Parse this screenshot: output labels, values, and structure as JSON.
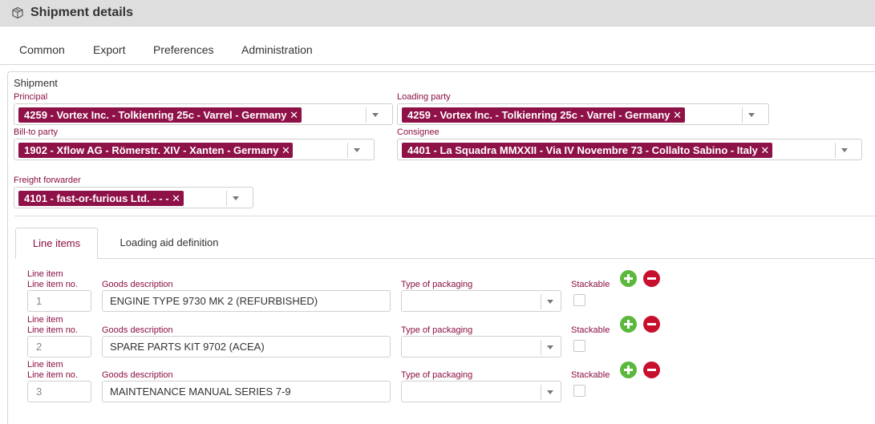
{
  "window": {
    "title": "Shipment details",
    "icon": "package-icon"
  },
  "menu": {
    "items": [
      {
        "label": "Common"
      },
      {
        "label": "Export"
      },
      {
        "label": "Preferences"
      },
      {
        "label": "Administration"
      }
    ]
  },
  "shipment": {
    "section_title": "Shipment",
    "principal": {
      "label": "Principal",
      "value": "4259 - Vortex Inc. - Tolkienring 25c - Varrel - Germany"
    },
    "loading_party": {
      "label": "Loading party",
      "value": "4259 - Vortex Inc. - Tolkienring 25c - Varrel - Germany"
    },
    "bill_to_party": {
      "label": "Bill-to party",
      "value": "1902 - Xflow AG - Römerstr. XIV - Xanten - Germany"
    },
    "consignee": {
      "label": "Consignee",
      "value": "4401 - La Squadra MMXXII - Via IV Novembre 73 - Collalto Sabino - Italy"
    },
    "freight_forwarder": {
      "label": "Freight forwarder",
      "value": "4101 - fast-or-furious Ltd. - - -"
    },
    "chip_remove_glyph": "✕"
  },
  "tabs": [
    {
      "label": "Line items",
      "active": true
    },
    {
      "label": "Loading aid definition",
      "active": false
    }
  ],
  "line_items": {
    "labels": {
      "group": "Line item",
      "number": "Line item no.",
      "description": "Goods description",
      "packaging": "Type of packaging",
      "stackable": "Stackable"
    },
    "rows": [
      {
        "number": "1",
        "description": "ENGINE TYPE 9730 MK 2 (REFURBISHED)",
        "packaging": "",
        "stackable": false
      },
      {
        "number": "2",
        "description": "SPARE PARTS KIT 9702 (ACEA)",
        "packaging": "",
        "stackable": false
      },
      {
        "number": "3",
        "description": "MAINTENANCE MANUAL SERIES 7-9",
        "packaging": "",
        "stackable": false
      }
    ]
  },
  "colors": {
    "accent": "#8b1043",
    "chip_background": "#8e1147",
    "add_button": "#5cb83c",
    "remove_button": "#c8102e",
    "titlebar": "#dedede"
  }
}
